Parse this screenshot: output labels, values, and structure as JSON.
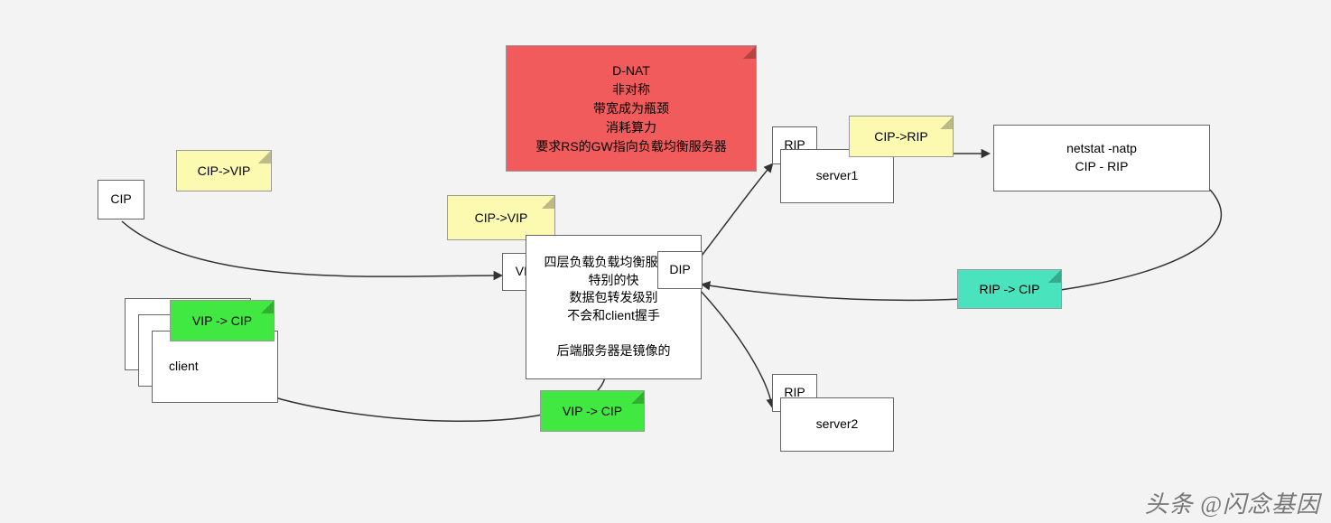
{
  "nodes": {
    "cip": "CIP",
    "client": "client",
    "vip": "VIP",
    "dip": "DIP",
    "rip1": "RIP",
    "server1": "server1",
    "rip2": "RIP",
    "server2": "server2",
    "netstat": "netstat -natp\nCIP - RIP",
    "lb": "四层负载负载均衡服务器\n特别的快\n数据包转发级别\n不会和client握手\n\n后端服务器是镜像的"
  },
  "notes": {
    "cip_vip_left": "CIP->VIP",
    "vip_cip_left": "VIP -> CIP",
    "cip_vip_mid": "CIP->VIP",
    "vip_cip_mid": "VIP -> CIP",
    "cip_rip": "CIP->RIP",
    "rip_cip": "RIP -> CIP",
    "dnat": "D-NAT\n非对称\n带宽成为瓶颈\n消耗算力\n要求RS的GW指向负载均衡服务器"
  },
  "watermark": "头条 @闪念基因"
}
